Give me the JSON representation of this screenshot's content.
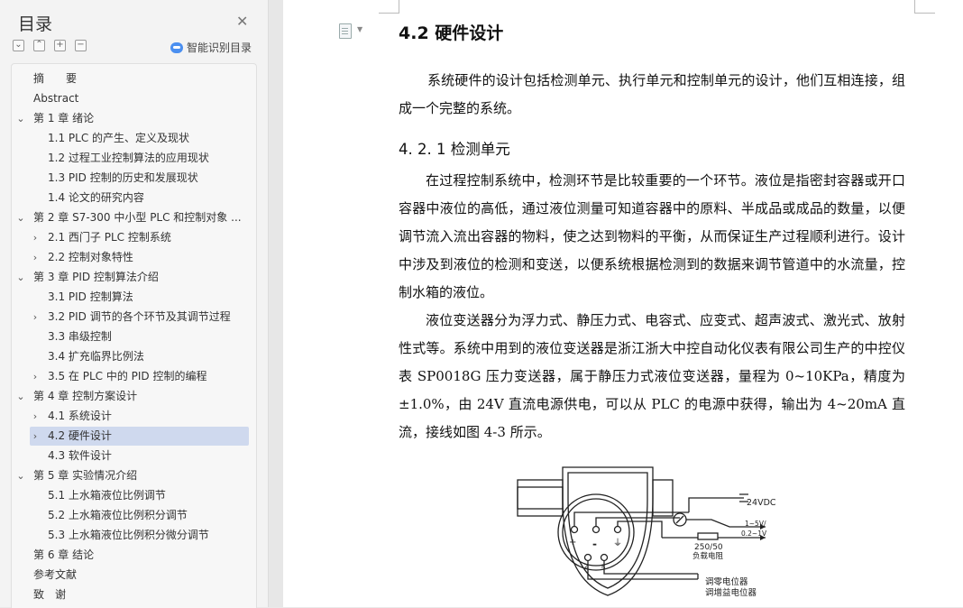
{
  "sidebar": {
    "title": "目录",
    "close_icon": "close-icon",
    "tools": {
      "collapse_all": "collapse-all-icon",
      "expand_all": "expand-all-icon",
      "add": "plus-icon",
      "remove": "minus-icon"
    },
    "ai_label": "智能识别目录",
    "items": [
      {
        "label": "摘　　要",
        "level": 0,
        "chevron": "none"
      },
      {
        "label": "Abstract",
        "level": 0,
        "chevron": "none"
      },
      {
        "label": "第 1 章  绪论",
        "level": 0,
        "chevron": "down"
      },
      {
        "label": "1.1 PLC 的产生、定义及现状",
        "level": 1,
        "chevron": "none"
      },
      {
        "label": "1.2  过程工业控制算法的应用现状",
        "level": 1,
        "chevron": "none"
      },
      {
        "label": "1.3 PID 控制的历史和发展现状",
        "level": 1,
        "chevron": "none"
      },
      {
        "label": "1.4  论文的研究内容",
        "level": 1,
        "chevron": "none"
      },
      {
        "label": "第 2 章  S7-300 中小型 PLC 和控制对象 ...",
        "level": 0,
        "chevron": "down"
      },
      {
        "label": "2.1  西门子 PLC 控制系统",
        "level": 1,
        "chevron": "right"
      },
      {
        "label": "2.2  控制对象特性",
        "level": 1,
        "chevron": "right"
      },
      {
        "label": "第 3 章  PID 控制算法介绍",
        "level": 0,
        "chevron": "down"
      },
      {
        "label": "3.1 PID 控制算法",
        "level": 1,
        "chevron": "none"
      },
      {
        "label": "3.2 PID 调节的各个环节及其调节过程",
        "level": 1,
        "chevron": "right"
      },
      {
        "label": "3.3  串级控制",
        "level": 1,
        "chevron": "none"
      },
      {
        "label": "3.4  扩充临界比例法",
        "level": 1,
        "chevron": "none"
      },
      {
        "label": "3.5 在 PLC 中的 PID 控制的编程",
        "level": 1,
        "chevron": "right"
      },
      {
        "label": "第 4 章  控制方案设计",
        "level": 0,
        "chevron": "down"
      },
      {
        "label": "4.1  系统设计",
        "level": 1,
        "chevron": "right"
      },
      {
        "label": "4.2  硬件设计",
        "level": 1,
        "chevron": "right",
        "selected": true
      },
      {
        "label": "4.3  软件设计",
        "level": 1,
        "chevron": "none"
      },
      {
        "label": "第 5 章    实验情况介绍",
        "level": 0,
        "chevron": "down"
      },
      {
        "label": "5.1  上水箱液位比例调节",
        "level": 1,
        "chevron": "none"
      },
      {
        "label": "5.2  上水箱液位比例积分调节",
        "level": 1,
        "chevron": "none"
      },
      {
        "label": "5.3  上水箱液位比例积分微分调节",
        "level": 1,
        "chevron": "none"
      },
      {
        "label": "第 6 章  结论",
        "level": 0,
        "chevron": "none"
      },
      {
        "label": "参考文献",
        "level": 0,
        "chevron": "none"
      },
      {
        "label": "致　谢",
        "level": 0,
        "chevron": "none"
      }
    ]
  },
  "document": {
    "heading": "4.2  硬件设计",
    "p1": "系统硬件的设计包括检测单元、执行单元和控制单元的设计，他们互相连接，组成一个完整的系统。",
    "subheading": "4. 2. 1  检测单元",
    "p2": "在过程控制系统中，检测环节是比较重要的一个环节。液位是指密封容器或开口容器中液位的高低，通过液位测量可知道容器中的原料、半成品或成品的数量，以便调节流入流出容器的物料，使之达到物料的平衡，从而保证生产过程顺利进行。设计中涉及到液位的检测和变送，以便系统根据检测到的数据来调节管道中的水流量，控制水箱的液位。",
    "p3": "液位变送器分为浮力式、静压力式、电容式、应变式、超声波式、激光式、放射性式等。系统中用到的液位变送器是浙江浙大中控自动化仪表有限公司生产的中控仪表 SP0018G 压力变送器，属于静压力式液位变送器，量程为 0~10KPa，精度为±1.0%，由 24V 直流电源供电，可以从 PLC 的电源中获得，输出为 4~20mA 直流，接线如图 4-3 所示。",
    "figure": {
      "v24": "24VDC",
      "out1": "1~5V/",
      "out2": "0.2~1V",
      "resistor1": "250/50",
      "resistor2": "负载电阻",
      "plus": "+",
      "minus": "-",
      "z": "Z",
      "r": "R",
      "zero_pot": "调零电位器",
      "gain_pot": "调增益电位器"
    }
  }
}
